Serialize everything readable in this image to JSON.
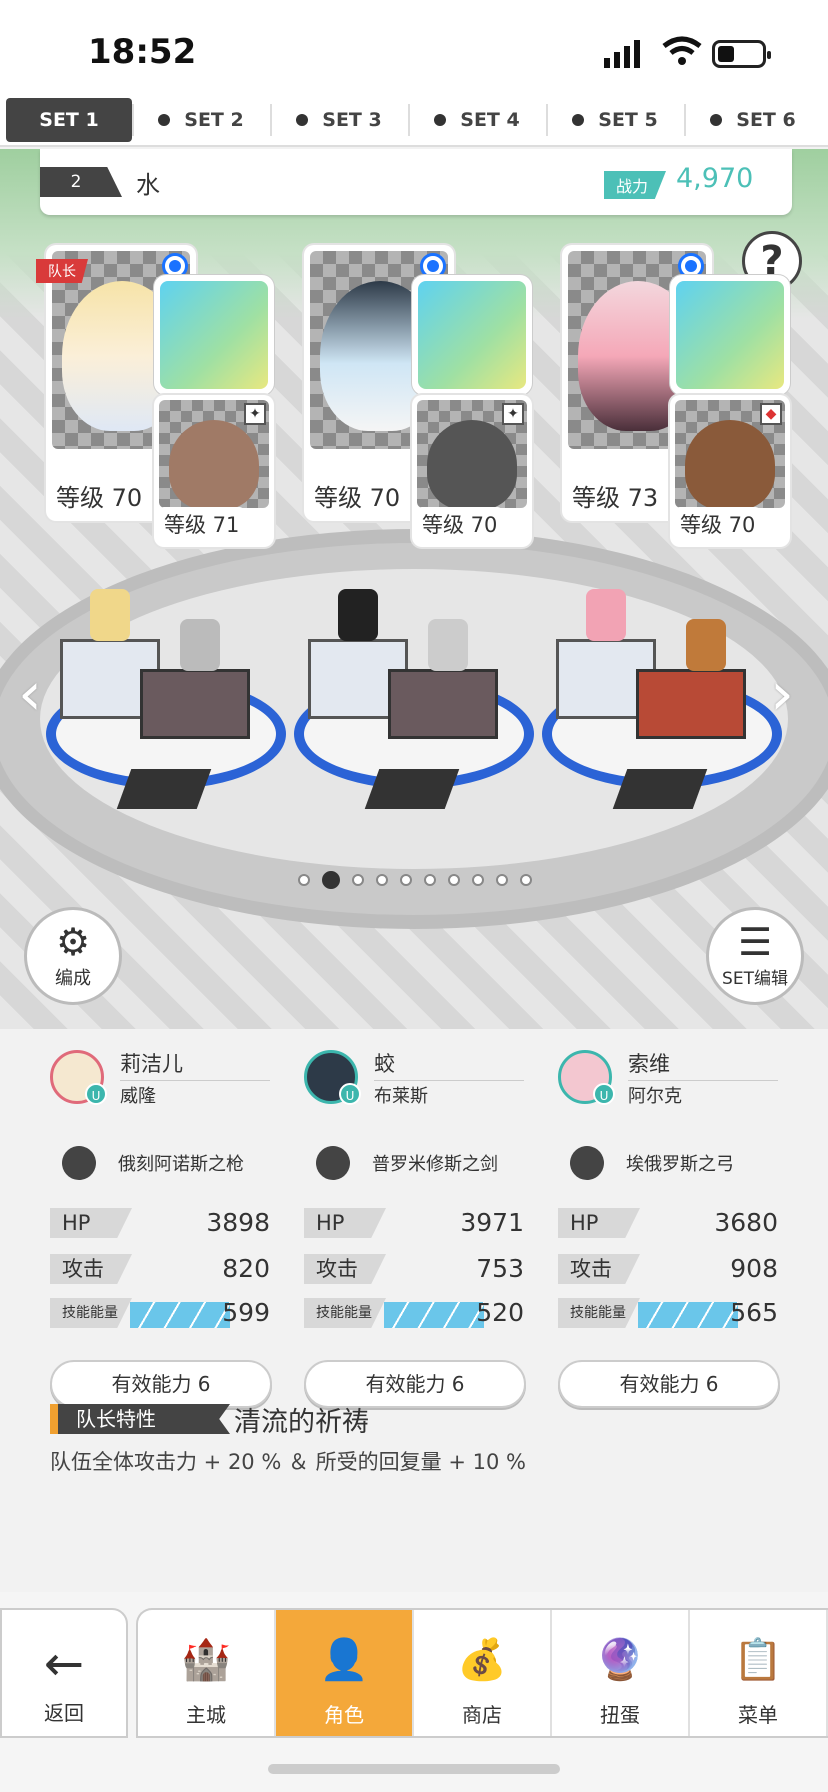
{
  "status_bar": {
    "time": "18:52"
  },
  "tabs": [
    "SET 1",
    "SET 2",
    "SET 3",
    "SET 4",
    "SET 5",
    "SET 6"
  ],
  "team": {
    "number": "2",
    "name": "水",
    "power_label": "战力",
    "power_value": "4,970"
  },
  "help_icon": "?",
  "leader_badge": "队长",
  "cards": [
    {
      "level": "等级 70",
      "sub_level": "等级 71"
    },
    {
      "level": "等级 70",
      "sub_level": "等级 70"
    },
    {
      "level": "等级 73",
      "sub_level": "等级 70"
    }
  ],
  "pager": {
    "count": 10,
    "active_index": 1
  },
  "buttons": {
    "formation": "编成",
    "set_edit": "SET编辑"
  },
  "characters": [
    {
      "name": "莉洁儿",
      "support": "威隆",
      "weapon": "俄刻阿诺斯之枪",
      "hp_label": "HP",
      "hp": "3898",
      "atk_label": "攻击",
      "atk": "820",
      "sp_label": "技能能量",
      "sp": "599",
      "effect": "有效能力 6"
    },
    {
      "name": "蛟",
      "support": "布莱斯",
      "weapon": "普罗米修斯之剑",
      "hp_label": "HP",
      "hp": "3971",
      "atk_label": "攻击",
      "atk": "753",
      "sp_label": "技能能量",
      "sp": "520",
      "effect": "有效能力 6"
    },
    {
      "name": "索维",
      "support": "阿尔克",
      "weapon": "埃俄罗斯之弓",
      "hp_label": "HP",
      "hp": "3680",
      "atk_label": "攻击",
      "atk": "908",
      "sp_label": "技能能量",
      "sp": "565",
      "effect": "有效能力 6"
    }
  ],
  "leader_trait": {
    "label": "队长特性",
    "name": "清流的祈祷",
    "description": "队伍全体攻击力 + 20 % ＆ 所受的回复量 + 10 %"
  },
  "nav": {
    "back": "返回",
    "items": [
      "主城",
      "角色",
      "商店",
      "扭蛋",
      "菜单"
    ],
    "active": "角色"
  }
}
